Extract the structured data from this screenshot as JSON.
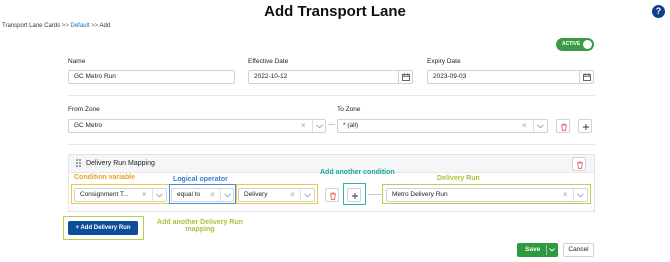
{
  "page": {
    "title": "Add Transport Lane",
    "help_glyph": "?"
  },
  "breadcrumb": {
    "root": "Transport Lane Cards",
    "separator": ">>",
    "middle": "Default",
    "current": "Add"
  },
  "status_toggle": {
    "label": "ACTIVE",
    "on": true
  },
  "form": {
    "name": {
      "label": "Name",
      "value": "GC Metro Run"
    },
    "effective_date": {
      "label": "Effective Date",
      "value": "2022-10-12"
    },
    "expiry_date": {
      "label": "Expiry Date",
      "value": "2023-09-03"
    },
    "from_zone": {
      "label": "From Zone",
      "value": "GC Metro"
    },
    "zone_separator": "—",
    "to_zone": {
      "label": "To Zone",
      "value": "* (all)"
    }
  },
  "mapping": {
    "title": "Delivery Run Mapping",
    "condition_variable": "Consignment T...",
    "logical_operator": "equal to",
    "condition_value": "Delivery",
    "delivery_run": "Metro Delivery Run",
    "add_button_label": "Add Delivery Run"
  },
  "annotations": {
    "condition_variable": "Condition variable",
    "logical_operator": "Logical operator",
    "add_condition": "Add another condition",
    "delivery_run": "Delivery Run",
    "add_delivery_run_line1": "Add another Delivery Run",
    "add_delivery_run_line2": "mapping"
  },
  "footer": {
    "save_label": "Save",
    "cancel_label": "Cancel"
  },
  "colors": {
    "primary": "#0d4d9a",
    "success": "#2d9a3f",
    "danger": "#e05252",
    "annotation_orange": "#e9a41f",
    "annotation_blue": "#3a7ccf",
    "annotation_teal": "#18a89a",
    "annotation_yellow_green": "#a8c23c"
  }
}
